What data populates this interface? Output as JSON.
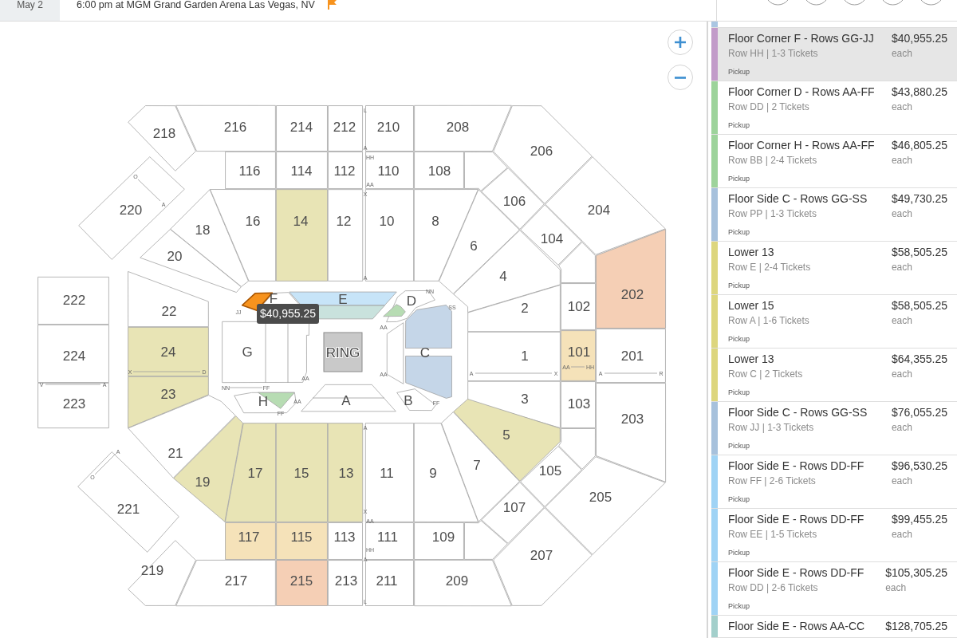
{
  "event_bar": {
    "date": "May 2",
    "details": "6:00 pm at MGM Grand Garden Arena Las Vegas, NV"
  },
  "map": {
    "sections": [
      {
        "label": "218",
        "color": "#ffffff",
        "selected": false
      },
      {
        "label": "216",
        "color": "#ffffff",
        "selected": false
      },
      {
        "label": "214",
        "color": "#ffffff",
        "selected": false
      },
      {
        "label": "212",
        "color": "#ffffff",
        "selected": false
      },
      {
        "label": "210",
        "color": "#ffffff",
        "selected": false
      },
      {
        "label": "208",
        "color": "#ffffff",
        "selected": false
      },
      {
        "label": "206",
        "color": "#ffffff",
        "selected": false
      },
      {
        "label": "116",
        "color": "#ffffff",
        "selected": false
      },
      {
        "label": "114",
        "color": "#ffffff",
        "selected": false
      },
      {
        "label": "112",
        "color": "#ffffff",
        "selected": false
      },
      {
        "label": "110",
        "color": "#ffffff",
        "selected": false
      },
      {
        "label": "108",
        "color": "#ffffff",
        "selected": false
      },
      {
        "label": "220",
        "color": "#ffffff",
        "selected": false
      },
      {
        "label": "106",
        "color": "#ffffff",
        "selected": false
      },
      {
        "label": "204",
        "color": "#ffffff",
        "selected": false
      },
      {
        "label": "18",
        "color": "#ffffff",
        "selected": false
      },
      {
        "label": "16",
        "color": "#ffffff",
        "selected": false
      },
      {
        "label": "14",
        "color": "#e8e4b5",
        "selected": false
      },
      {
        "label": "12",
        "color": "#ffffff",
        "selected": false
      },
      {
        "label": "10",
        "color": "#ffffff",
        "selected": false
      },
      {
        "label": "8",
        "color": "#ffffff",
        "selected": false
      },
      {
        "label": "104",
        "color": "#ffffff",
        "selected": false
      },
      {
        "label": "6",
        "color": "#ffffff",
        "selected": false
      },
      {
        "label": "20",
        "color": "#ffffff",
        "selected": false
      },
      {
        "label": "4",
        "color": "#ffffff",
        "selected": false
      },
      {
        "label": "202",
        "color": "#f5cfb5",
        "selected": false
      },
      {
        "label": "222",
        "color": "#ffffff",
        "selected": false
      },
      {
        "label": "22",
        "color": "#ffffff",
        "selected": false
      },
      {
        "label": "2",
        "color": "#ffffff",
        "selected": false
      },
      {
        "label": "102",
        "color": "#ffffff",
        "selected": false
      },
      {
        "label": "224",
        "color": "#ffffff",
        "selected": false
      },
      {
        "label": "24",
        "color": "#e8e4b5",
        "selected": false
      },
      {
        "label": "1",
        "color": "#ffffff",
        "selected": false
      },
      {
        "label": "101",
        "color": "#f5e2b9",
        "selected": false
      },
      {
        "label": "201",
        "color": "#ffffff",
        "selected": false
      },
      {
        "label": "223",
        "color": "#ffffff",
        "selected": false
      },
      {
        "label": "23",
        "color": "#e8e4b5",
        "selected": false
      },
      {
        "label": "3",
        "color": "#ffffff",
        "selected": false
      },
      {
        "label": "103",
        "color": "#ffffff",
        "selected": false
      },
      {
        "label": "203",
        "color": "#ffffff",
        "selected": false
      },
      {
        "label": "5",
        "color": "#e8e4b5",
        "selected": false
      },
      {
        "label": "21",
        "color": "#ffffff",
        "selected": false
      },
      {
        "label": "221",
        "color": "#ffffff",
        "selected": false
      },
      {
        "label": "7",
        "color": "#ffffff",
        "selected": false
      },
      {
        "label": "105",
        "color": "#ffffff",
        "selected": false
      },
      {
        "label": "205",
        "color": "#ffffff",
        "selected": false
      },
      {
        "label": "19",
        "color": "#e8e4b5",
        "selected": false
      },
      {
        "label": "17",
        "color": "#e8e4b5",
        "selected": false
      },
      {
        "label": "15",
        "color": "#e8e4b5",
        "selected": false
      },
      {
        "label": "13",
        "color": "#e8e4b5",
        "selected": false
      },
      {
        "label": "11",
        "color": "#ffffff",
        "selected": false
      },
      {
        "label": "9",
        "color": "#ffffff",
        "selected": false
      },
      {
        "label": "107",
        "color": "#ffffff",
        "selected": false
      },
      {
        "label": "117",
        "color": "#f5e2b9",
        "selected": false
      },
      {
        "label": "115",
        "color": "#f5e2b9",
        "selected": false
      },
      {
        "label": "113",
        "color": "#ffffff",
        "selected": false
      },
      {
        "label": "111",
        "color": "#ffffff",
        "selected": false
      },
      {
        "label": "109",
        "color": "#ffffff",
        "selected": false
      },
      {
        "label": "207",
        "color": "#ffffff",
        "selected": false
      },
      {
        "label": "219",
        "color": "#ffffff",
        "selected": false
      },
      {
        "label": "217",
        "color": "#ffffff",
        "selected": false
      },
      {
        "label": "215",
        "color": "#f5cfb5",
        "selected": false
      },
      {
        "label": "213",
        "color": "#ffffff",
        "selected": false
      },
      {
        "label": "211",
        "color": "#ffffff",
        "selected": false
      },
      {
        "label": "209",
        "color": "#ffffff",
        "selected": false
      },
      {
        "label": "E",
        "color": "#c7e4f8",
        "selected": false
      },
      {
        "color": "#c9e2dd",
        "selected": false
      },
      {
        "label": "D",
        "color": "#ffffff",
        "selected": false
      },
      {
        "color": "#b7dcb3",
        "selected": false
      },
      {
        "label": "C",
        "color": "#c5d6e8",
        "selected": false
      },
      {
        "color": "#c5d6e8",
        "selected": false
      },
      {
        "label": "F",
        "color": "#ffffff",
        "selected": false
      },
      {
        "color": "#f7931e",
        "selected": true
      },
      {
        "label": "G",
        "color": "#ffffff",
        "selected": false
      },
      {
        "label": "H",
        "color": "#ffffff",
        "selected": false
      },
      {
        "color": "#b7dcb3",
        "selected": false
      },
      {
        "label": "A",
        "color": "#ffffff",
        "selected": false
      },
      {
        "label": "B",
        "color": "#ffffff",
        "selected": false
      }
    ],
    "ring_label": "RING",
    "row_marks": [
      "L",
      "A",
      "HH",
      "AA",
      "X",
      "A",
      "A",
      "X",
      "AA",
      "HH",
      "A",
      "L",
      "A",
      "X",
      "AA",
      "HH",
      "A",
      "R",
      "X",
      "D",
      "V",
      "A",
      "O",
      "A",
      "A",
      "O",
      "JJ",
      "NN",
      "SS",
      "AA",
      "NN",
      "FF",
      "AA",
      "AA",
      "FF",
      "AA",
      "FF"
    ],
    "price_tooltip": "$40,955.25"
  },
  "listings": {
    "items": [
      {
        "color": "#a9c6e2",
        "selected": false
      },
      {
        "title": "Floor Corner F - Rows GG-JJ",
        "detail": "Row HH | 1-3 Tickets",
        "delivery": "Pickup",
        "price": "$40,955.25",
        "unit": "each",
        "color": "#c29bc9",
        "selected": true
      },
      {
        "title": "Floor Corner D - Rows AA-FF",
        "detail": "Row DD | 2 Tickets",
        "delivery": "Pickup",
        "price": "$43,880.25",
        "unit": "each",
        "color": "#9dd39b",
        "selected": false
      },
      {
        "title": "Floor Corner H - Rows AA-FF",
        "detail": "Row BB | 2-4 Tickets",
        "delivery": "Pickup",
        "price": "$46,805.25",
        "unit": "each",
        "color": "#9dd39b",
        "selected": false
      },
      {
        "title": "Floor Side C - Rows GG-SS",
        "detail": "Row PP | 1-3 Tickets",
        "delivery": "Pickup",
        "price": "$49,730.25",
        "unit": "each",
        "color": "#a7c1dc",
        "selected": false
      },
      {
        "title": "Lower 13",
        "detail": "Row E | 2-4 Tickets",
        "delivery": "Pickup",
        "price": "$58,505.25",
        "unit": "each",
        "color": "#ddd67e",
        "selected": false
      },
      {
        "title": "Lower 15",
        "detail": "Row A | 1-6 Tickets",
        "delivery": "Pickup",
        "price": "$58,505.25",
        "unit": "each",
        "color": "#ddd67e",
        "selected": false
      },
      {
        "title": "Lower 13",
        "detail": "Row C | 2 Tickets",
        "delivery": "Pickup",
        "price": "$64,355.25",
        "unit": "each",
        "color": "#ddd67e",
        "selected": false
      },
      {
        "title": "Floor Side C - Rows GG-SS",
        "detail": "Row JJ | 1-3 Tickets",
        "delivery": "Pickup",
        "price": "$76,055.25",
        "unit": "each",
        "color": "#a7c1dc",
        "selected": false
      },
      {
        "title": "Floor Side E - Rows DD-FF",
        "detail": "Row FF | 2-6 Tickets",
        "delivery": "Pickup",
        "price": "$96,530.25",
        "unit": "each",
        "color": "#9fd3f5",
        "selected": false
      },
      {
        "title": "Floor Side E - Rows DD-FF",
        "detail": "Row EE | 1-5 Tickets",
        "delivery": "Pickup",
        "price": "$99,455.25",
        "unit": "each",
        "color": "#9fd3f5",
        "selected": false
      },
      {
        "title": "Floor Side E - Rows DD-FF",
        "detail": "Row DD | 2-6 Tickets",
        "delivery": "Pickup",
        "price": "$105,305.25",
        "unit": "each",
        "color": "#9fd3f5",
        "selected": false
      },
      {
        "title": "Floor Side E - Rows AA-CC",
        "price": "$128,705.25",
        "color": "#a3cfcb",
        "selected": false
      }
    ]
  }
}
